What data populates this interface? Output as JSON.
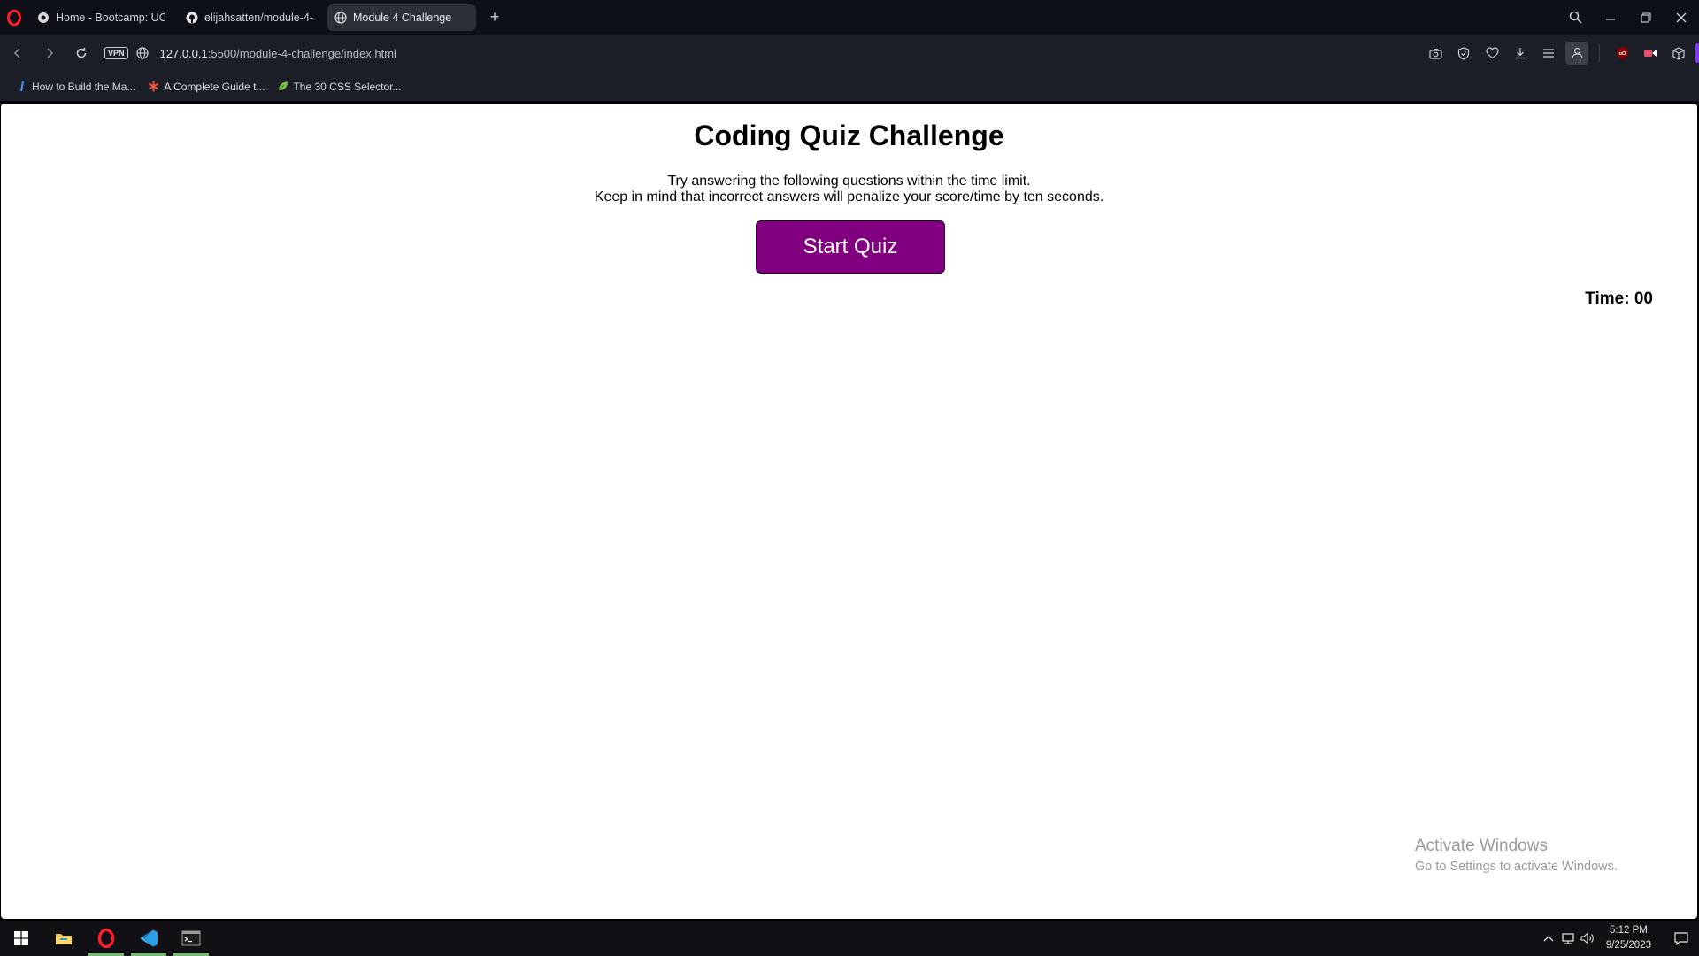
{
  "browser": {
    "tabs": [
      {
        "title": "Home - Bootcamp: UCF-V",
        "active": false,
        "favicon": "canvas-icon"
      },
      {
        "title": "elijahsatten/module-4-ch",
        "active": false,
        "favicon": "github-icon"
      },
      {
        "title": "Module 4 Challenge",
        "active": true,
        "favicon": "globe-icon"
      }
    ],
    "url_host": "127.0.0.1",
    "url_rest": ":5500/module-4-challenge/index.html",
    "vpn_label": "VPN",
    "bookmarks": [
      {
        "label": "How to Build the Ma...",
        "icon": "bookmark-blue-icon"
      },
      {
        "label": "A Complete Guide t...",
        "icon": "asterisk-icon"
      },
      {
        "label": "The 30 CSS Selector...",
        "icon": "leaf-icon"
      }
    ]
  },
  "page": {
    "title": "Coding Quiz Challenge",
    "intro_line1": "Try answering the following questions within the time limit.",
    "intro_line2": "Keep in mind that incorrect answers will penalize your score/time by ten seconds.",
    "start_button": "Start Quiz",
    "timer": "Time: 00",
    "colors": {
      "button": "#800080"
    }
  },
  "watermark": {
    "line1": "Activate Windows",
    "line2": "Go to Settings to activate Windows."
  },
  "taskbar": {
    "time": "5:12 PM",
    "date": "9/25/2023"
  }
}
